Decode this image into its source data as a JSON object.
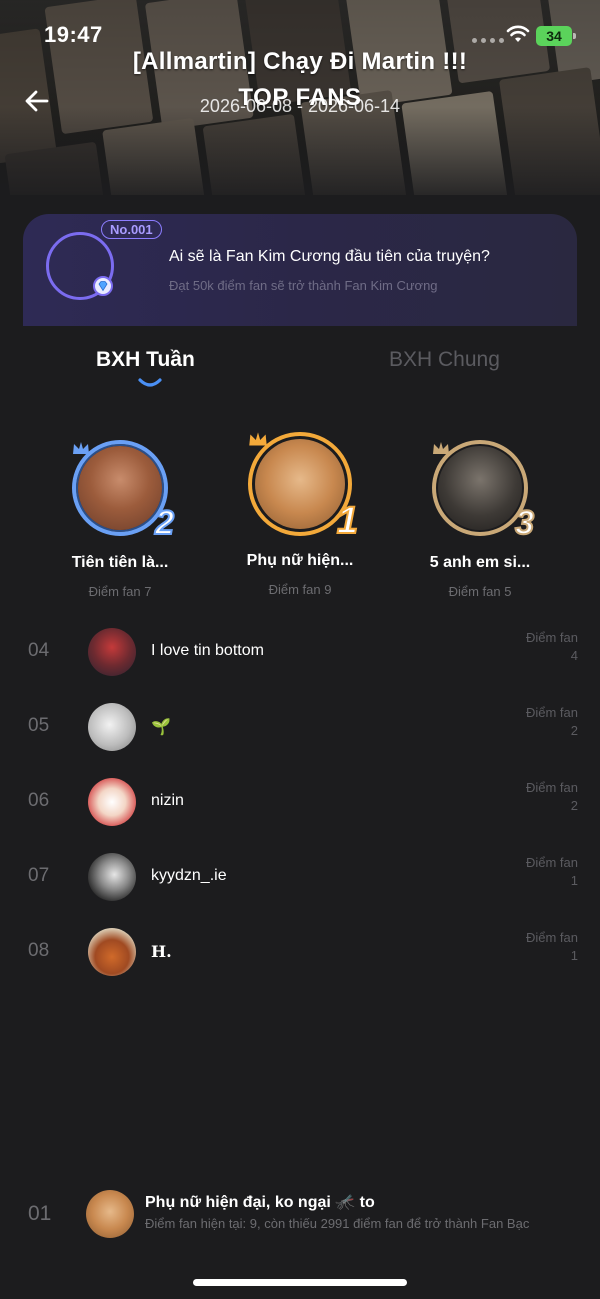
{
  "status_bar": {
    "time": "19:47",
    "battery": "34"
  },
  "header": {
    "title": "[Allmartin] Chạy Đi Martin !!!",
    "subtitle": "TOP FANS",
    "date_range": "2026-06-08 - 2026-06-14",
    "back_icon": "arrow-left-icon"
  },
  "promo": {
    "badge": "No.001",
    "question": "Ai sẽ là Fan Kim Cương đầu tiên của truyện?",
    "hint": "Đạt 50k điểm fan sẽ trở thành Fan Kim Cương",
    "icon": "diamond-icon"
  },
  "tabs": [
    {
      "label": "BXH Tuần",
      "active": true
    },
    {
      "label": "BXH Chung",
      "active": false
    }
  ],
  "podium": [
    {
      "rank": "2",
      "name": "Tiên tiên là...",
      "score": "Điểm fan 7",
      "ring_color": "#6aa0f5"
    },
    {
      "rank": "1",
      "name": "Phụ nữ hiện...",
      "score": "Điểm fan 9",
      "ring_color": "#f3a93a"
    },
    {
      "rank": "3",
      "name": "5 anh em si...",
      "score": "Điểm fan 5",
      "ring_color": "#c9a877"
    }
  ],
  "ranking_list": {
    "score_label": "Điểm fan",
    "rows": [
      {
        "rank": "04",
        "name": "I love tin bottom",
        "score": "4"
      },
      {
        "rank": "05",
        "name": "🌱",
        "score": "2"
      },
      {
        "rank": "06",
        "name": "nizin",
        "score": "2"
      },
      {
        "rank": "07",
        "name": "kyydzn_.ie",
        "score": "1"
      },
      {
        "rank": "08",
        "name": "𝐇.",
        "score": "1"
      }
    ]
  },
  "current_user": {
    "rank": "01",
    "name": "Phụ nữ hiện đại, ko ngại 🦟 to",
    "progress": "Điểm fan hiện tại: 9, còn thiếu 2991 điểm fan để trở thành Fan Bạc"
  }
}
